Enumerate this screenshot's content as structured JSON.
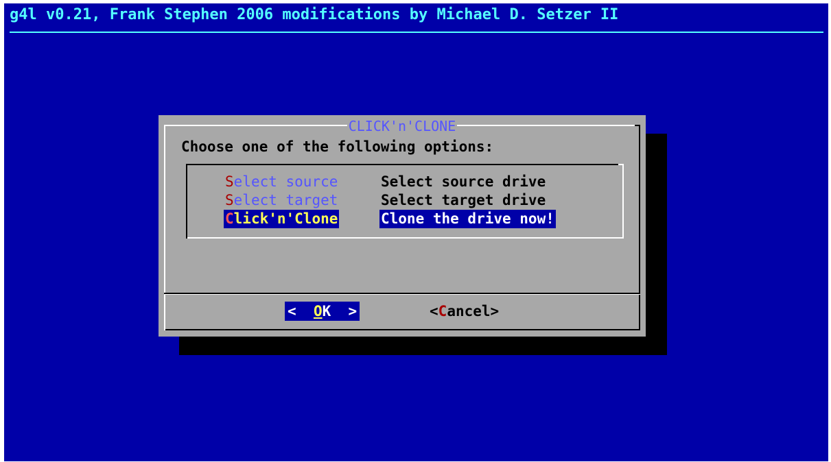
{
  "backtitle": "g4l v0.21, Frank Stephen 2006 modifications by Michael D. Setzer II",
  "dialog": {
    "title": "CLICK'n'CLONE",
    "prompt": "Choose one of the following options:",
    "menu": [
      {
        "hotkey": "S",
        "tag_rest": "elect source",
        "description": "Select source drive",
        "selected": false
      },
      {
        "hotkey": "S",
        "tag_rest": "elect target",
        "description": "Select target drive",
        "selected": false
      },
      {
        "hotkey": "C",
        "tag_rest": "lick'n'Clone",
        "description": "Clone the drive now!",
        "selected": true
      }
    ],
    "buttons": {
      "ok": {
        "prefix": "<  ",
        "hotkey": "O",
        "rest": "K",
        "suffix": "  >"
      },
      "cancel": {
        "prefix": "<",
        "hotkey": "C",
        "rest": "ancel",
        "suffix": ">"
      }
    }
  },
  "colors": {
    "screen_background": "#0000a8",
    "dialog_background": "#a8a8a8",
    "backtitle": "#55ffff",
    "hotkey": "#a80000",
    "selected_background": "#0000a8",
    "selected_tag": "#ffff55"
  }
}
